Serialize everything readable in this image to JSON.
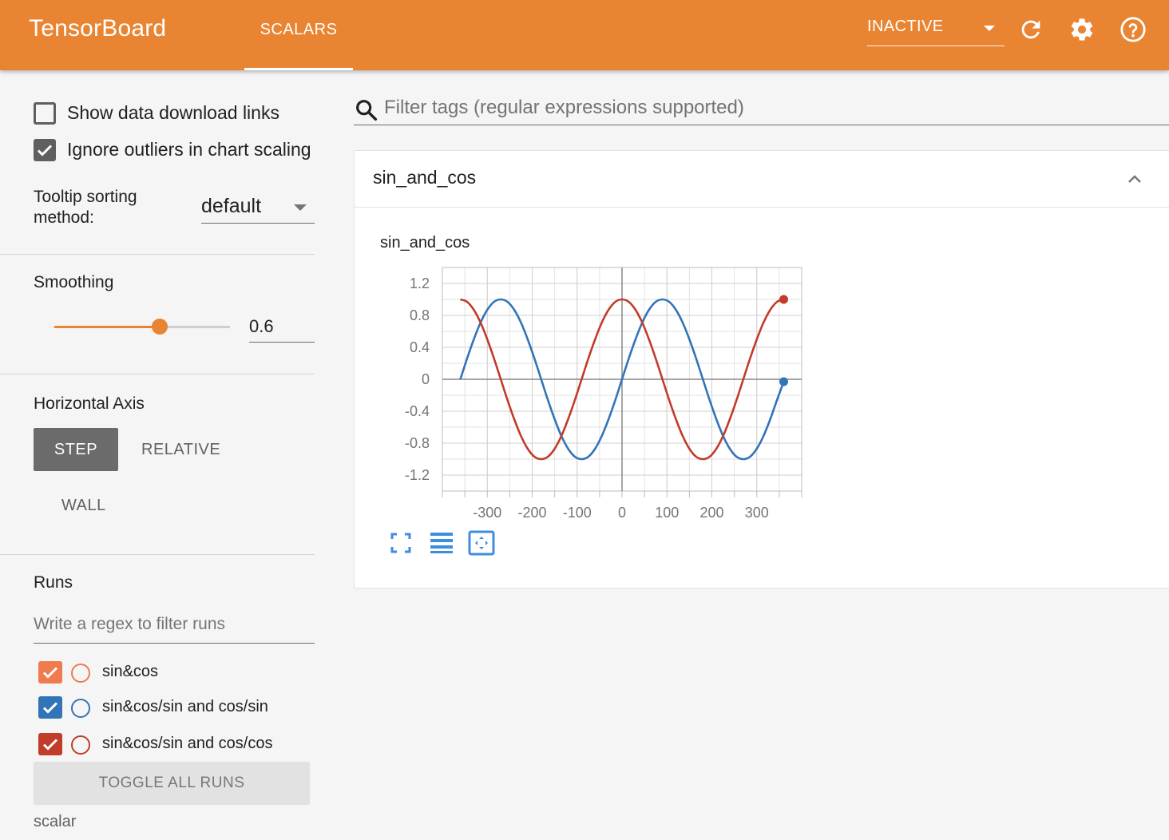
{
  "app": {
    "title": "TensorBoard",
    "tab": "SCALARS",
    "status": "INACTIVE",
    "accent_color": "#e98532",
    "icons": [
      "refresh-icon",
      "settings-icon",
      "help-icon"
    ]
  },
  "sidebar": {
    "show_download": {
      "label": "Show data download links",
      "checked": false
    },
    "ignore_outliers": {
      "label": "Ignore outliers in chart scaling",
      "checked": true
    },
    "tooltip_sorting": {
      "label": "Tooltip sorting method:",
      "value": "default"
    },
    "smoothing": {
      "title": "Smoothing",
      "value": "0.6",
      "fraction": 0.6
    },
    "horizontal_axis": {
      "title": "Horizontal Axis",
      "options": [
        "STEP",
        "RELATIVE",
        "WALL"
      ],
      "selected": "STEP"
    },
    "runs": {
      "title": "Runs",
      "filter_placeholder": "Write a regex to filter runs",
      "items": [
        {
          "name": "sin&cos",
          "color": "#ef7b4f",
          "checked": true
        },
        {
          "name": "sin&cos/sin and cos/sin",
          "color": "#3274b8",
          "checked": true
        },
        {
          "name": "sin&cos/sin and cos/cos",
          "color": "#c13c29",
          "checked": true
        }
      ],
      "toggle_all": "TOGGLE ALL RUNS",
      "footer": "scalar"
    }
  },
  "main": {
    "filter_placeholder": "Filter tags (regular expressions supported)",
    "card": {
      "title": "sin_and_cos",
      "chart_title": "sin_and_cos"
    }
  },
  "chart_data": {
    "type": "line",
    "title": "sin_and_cos",
    "xlabel": "",
    "ylabel": "",
    "xlim": [
      -400,
      400
    ],
    "ylim": [
      -1.4,
      1.4
    ],
    "x_ticks": [
      -300,
      -200,
      -100,
      0,
      100,
      200,
      300
    ],
    "y_ticks": [
      -1.2,
      -0.8,
      -0.4,
      0,
      0.4,
      0.8,
      1.2
    ],
    "x_tick_labels": [
      "-300",
      "-200",
      "-100",
      "0",
      "100",
      "200",
      "300"
    ],
    "y_tick_labels": [
      "1.2",
      "0.8",
      "0.4",
      "0",
      "-0.4",
      "-0.8",
      "-1.2"
    ],
    "grid": true,
    "x": [
      -360,
      -345,
      -330,
      -315,
      -300,
      -285,
      -270,
      -255,
      -240,
      -225,
      -210,
      -195,
      -180,
      -165,
      -150,
      -135,
      -120,
      -105,
      -90,
      -75,
      -60,
      -45,
      -30,
      -15,
      0,
      15,
      30,
      45,
      60,
      75,
      90,
      105,
      120,
      135,
      150,
      165,
      180,
      195,
      210,
      225,
      240,
      255,
      270,
      285,
      300,
      315,
      330,
      345,
      360
    ],
    "series": [
      {
        "color": "#3274b8",
        "values": [
          0,
          0.26,
          0.5,
          0.71,
          0.87,
          0.97,
          1,
          0.97,
          0.87,
          0.71,
          0.5,
          0.26,
          0,
          -0.26,
          -0.5,
          -0.71,
          -0.87,
          -0.97,
          -1,
          -0.97,
          -0.87,
          -0.71,
          -0.5,
          -0.26,
          0,
          0.26,
          0.5,
          0.71,
          0.87,
          0.97,
          1,
          0.97,
          0.87,
          0.71,
          0.5,
          0.26,
          0,
          -0.26,
          -0.5,
          -0.71,
          -0.87,
          -0.97,
          -1,
          -0.97,
          -0.87,
          -0.71,
          -0.5,
          -0.26,
          -0.03
        ]
      },
      {
        "color": "#c13c29",
        "values": [
          1,
          0.97,
          0.87,
          0.71,
          0.5,
          0.26,
          0,
          -0.26,
          -0.5,
          -0.71,
          -0.87,
          -0.97,
          -1,
          -0.97,
          -0.87,
          -0.71,
          -0.5,
          -0.26,
          0,
          0.26,
          0.5,
          0.71,
          0.87,
          0.97,
          1,
          0.97,
          0.87,
          0.71,
          0.5,
          0.26,
          0,
          -0.26,
          -0.5,
          -0.71,
          -0.87,
          -0.97,
          -1,
          -0.97,
          -0.87,
          -0.71,
          -0.5,
          -0.26,
          0,
          0.26,
          0.5,
          0.71,
          0.87,
          0.97,
          1
        ]
      }
    ]
  }
}
